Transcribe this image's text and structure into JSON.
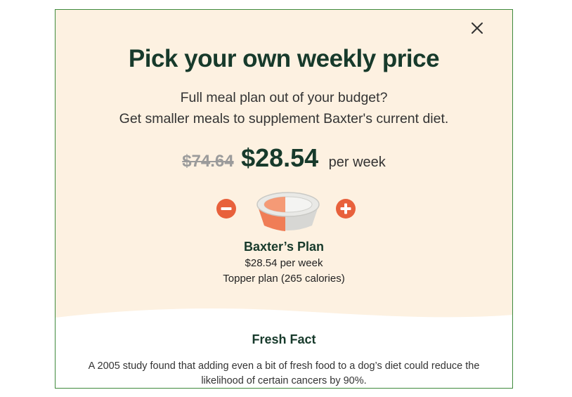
{
  "modal": {
    "close_icon": "close-icon",
    "title": "Pick your own weekly price",
    "subtitle_line1": "Full meal plan out of your budget?",
    "subtitle_line2": "Get smaller meals to supplement Baxter's current diet.",
    "price": {
      "original": "$74.64",
      "current": "$28.54",
      "unit": "per week"
    },
    "stepper": {
      "decrease_icon": "minus-circle-icon",
      "increase_icon": "plus-circle-icon",
      "bowl_icon": "dog-bowl-icon",
      "fill_fraction": 0.45
    },
    "plan": {
      "name": "Baxter’s Plan",
      "price_line": "$28.54 per week",
      "description": "Topper plan (265 calories)"
    },
    "fresh_fact": {
      "title": "Fresh Fact",
      "text": "A 2005 study found that adding even a bit of fresh food to a dog’s diet could reduce the likelihood of certain cancers by 90%."
    },
    "colors": {
      "background": "#fdf1e1",
      "title": "#173a2b",
      "accent": "#e8613c",
      "border": "#3f8a3c"
    }
  }
}
